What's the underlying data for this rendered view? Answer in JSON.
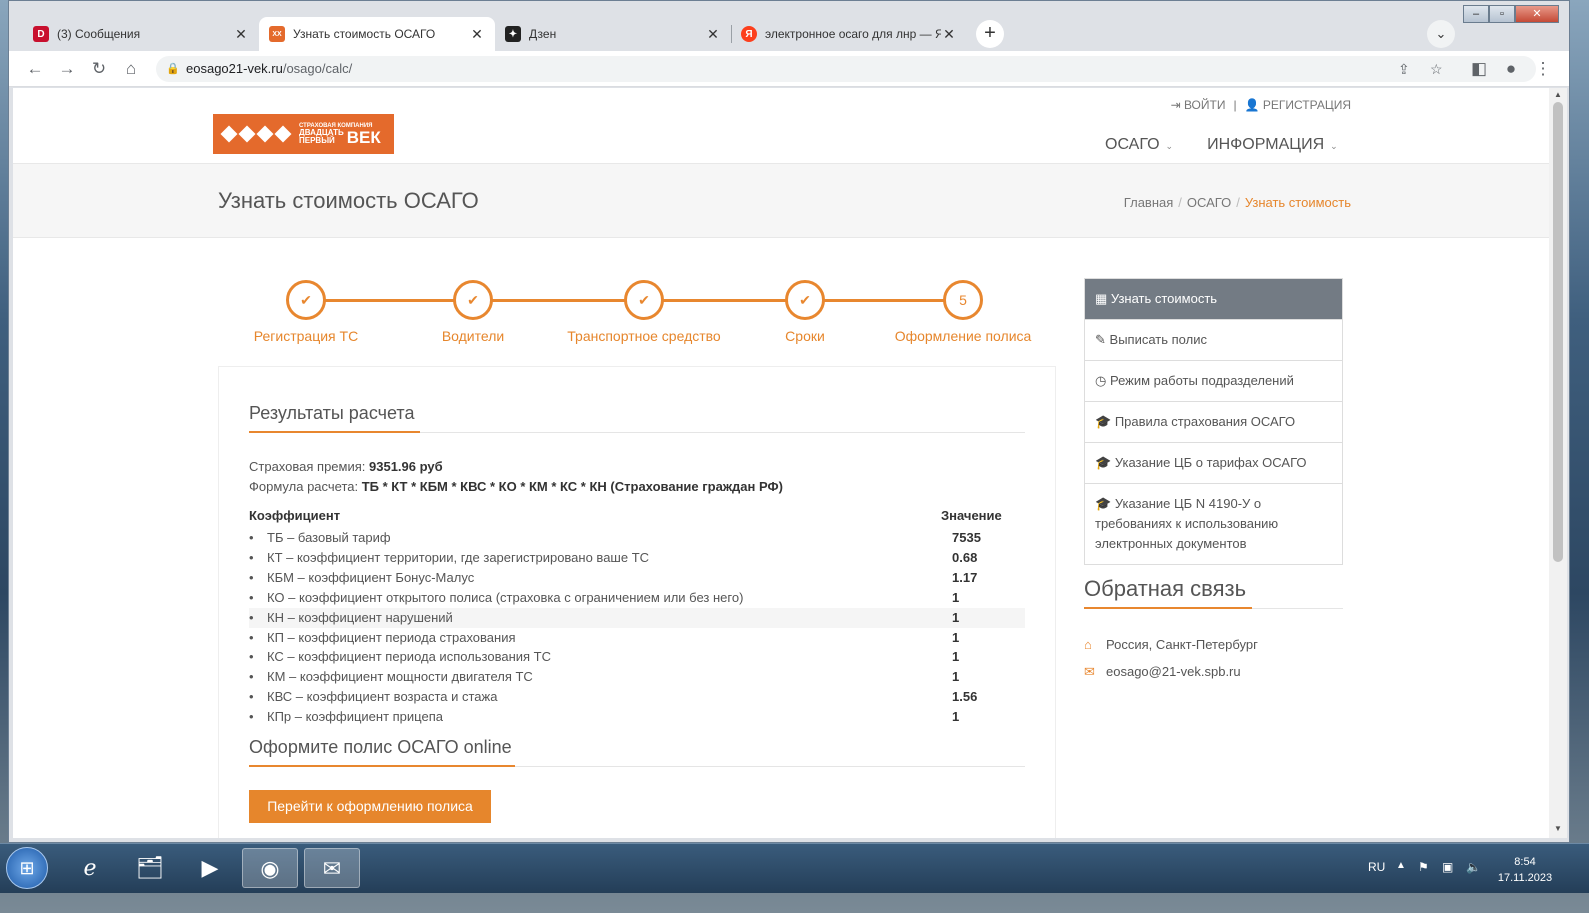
{
  "browser": {
    "tabs": [
      {
        "title": "(3) Сообщения",
        "favicon": "D"
      },
      {
        "title": "Узнать стоимость ОСАГО",
        "favicon": "XX",
        "active": true
      },
      {
        "title": "Дзен",
        "favicon": "✦"
      },
      {
        "title": "электронное осаго для лнр — Я",
        "favicon": "Я"
      }
    ],
    "url_host": "eosago21-vek.ru",
    "url_path": "/osago/calc/"
  },
  "site": {
    "login": "ВОЙТИ",
    "register": "РЕГИСТРАЦИЯ",
    "logo_small": "СТРАХОВАЯ КОМПАНИЯ",
    "logo_line1": "ДВАДЦАТЬ",
    "logo_line2": "ПЕРВЫЙ",
    "logo_big": "ВЕК",
    "nav": [
      "ОСАГО",
      "ИНФОРМАЦИЯ"
    ],
    "page_title": "Узнать стоимость ОСАГО",
    "breadcrumbs": [
      "Главная",
      "ОСАГО",
      "Узнать стоимость"
    ]
  },
  "steps": [
    {
      "label": "Регистрация ТС",
      "mark": "✔"
    },
    {
      "label": "Водители",
      "mark": "✔"
    },
    {
      "label": "Транспортное средство",
      "mark": "✔"
    },
    {
      "label": "Сроки",
      "mark": "✔"
    },
    {
      "label": "Оформление полиса",
      "mark": "5"
    }
  ],
  "results": {
    "title": "Результаты расчета",
    "premium_label": "Страховая премия:",
    "premium_value": "9351.96 руб",
    "formula_label": "Формула расчета:",
    "formula_value": "ТБ * КТ * КБМ * КВС * КО * КМ * КС * КН (Страхование граждан РФ)",
    "col_coef": "Коэффициент",
    "col_value": "Значение",
    "rows": [
      {
        "name": "ТБ – базовый тариф",
        "value": "7535"
      },
      {
        "name": "КТ – коэффициент территории, где зарегистрировано ваше ТС",
        "value": "0.68"
      },
      {
        "name": "КБМ – коэффициент Бонус-Малус",
        "value": "1.17"
      },
      {
        "name": "КО – коэффициент открытого полиса (страховка с ограничением или без него)",
        "value": "1"
      },
      {
        "name": "КН – коэффициент нарушений",
        "value": "1"
      },
      {
        "name": "КП – коэффициент периода страхования",
        "value": "1"
      },
      {
        "name": "КС – коэффициент периода использования ТС",
        "value": "1"
      },
      {
        "name": "КМ – коэффициент мощности двигателя ТС",
        "value": "1"
      },
      {
        "name": "КВС – коэффициент возраста и стажа",
        "value": "1.56"
      },
      {
        "name": "КПр – коэффициент прицепа",
        "value": "1"
      }
    ],
    "online_title": "Оформите полис ОСАГО online",
    "cta": "Перейти к оформлению полиса"
  },
  "sidebar": {
    "items": [
      {
        "label": "Узнать стоимость",
        "icon": "calculator-icon",
        "glyph": "▦"
      },
      {
        "label": "Выписать полис",
        "icon": "edit-icon",
        "glyph": "✎"
      },
      {
        "label": "Режим работы подразделений",
        "icon": "clock-icon",
        "glyph": "◷"
      },
      {
        "label": "Правила страхования ОСАГО",
        "icon": "graduation-cap-icon",
        "glyph": "🎓"
      },
      {
        "label": "Указание ЦБ о тарифах ОСАГО",
        "icon": "graduation-cap-icon",
        "glyph": "🎓"
      },
      {
        "label": "Указание ЦБ N 4190-У о требованиях к использованию электронных документов",
        "icon": "graduation-cap-icon",
        "glyph": "🎓"
      }
    ],
    "feedback_title": "Обратная связь",
    "address": "Россия, Санкт-Петербург",
    "email": "eosago@21-vek.spb.ru"
  },
  "taskbar": {
    "lang": "RU",
    "time": "8:54",
    "date": "17.11.2023"
  },
  "colors": {
    "accent": "#e8872f",
    "logo": "#e46a2c",
    "sidebar_active": "#737b84"
  }
}
